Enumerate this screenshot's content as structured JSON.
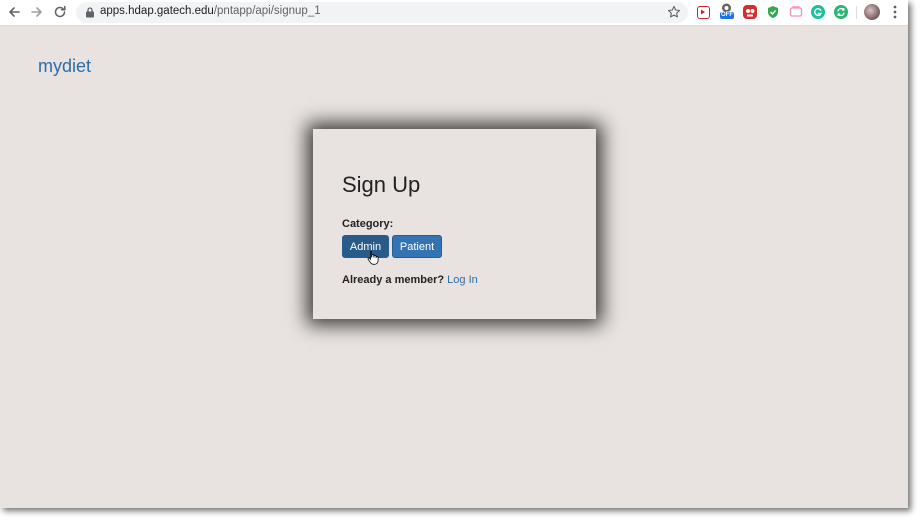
{
  "browser": {
    "url_host": "apps.hdap.gatech.edu",
    "url_path": "/pntapp/api/signup_1",
    "extensions": [
      "video-ext-icon",
      "off-toggle-ext-icon",
      "red-robot-ext-icon",
      "shield-ext-icon",
      "pink-ext-icon",
      "grammarly-icon",
      "sync-ext-icon"
    ],
    "extension_off_label": "OFF"
  },
  "page": {
    "brand": "mydiet",
    "card": {
      "title": "Sign Up",
      "category_label": "Category:",
      "buttons": {
        "admin": "Admin",
        "patient": "Patient"
      },
      "member_prompt": "Already a member?",
      "login_link": "Log In"
    }
  },
  "colors": {
    "background": "#e8e3e0",
    "link": "#2e6da4",
    "admin_button": "#285a8a",
    "patient_button": "#3574b2"
  }
}
